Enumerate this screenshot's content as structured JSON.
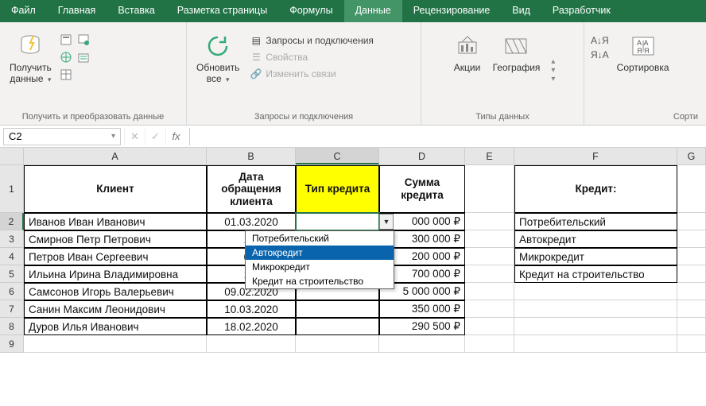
{
  "menu": [
    "Файл",
    "Главная",
    "Вставка",
    "Разметка страницы",
    "Формулы",
    "Данные",
    "Рецензирование",
    "Вид",
    "Разработчик"
  ],
  "menu_active_index": 5,
  "ribbon": {
    "groups": [
      {
        "label": "Получить и преобразовать данные",
        "get_data": "Получить\nданные"
      },
      {
        "label": "Запросы и подключения",
        "refresh": "Обновить\nвсе",
        "q_conn": "Запросы и подключения",
        "props": "Свойства",
        "edit_links": "Изменить связи"
      },
      {
        "label": "Типы данных",
        "stocks": "Акции",
        "geo": "География"
      },
      {
        "label": "Сорти",
        "sort": "Сортировка"
      }
    ]
  },
  "namebox": "C2",
  "col_letters": [
    "A",
    "B",
    "C",
    "D",
    "E",
    "F",
    "G"
  ],
  "row_heights": {
    "r1": 60,
    "rn": 22
  },
  "headers": {
    "A": "Клиент",
    "B": "Дата\nобращения\nклиента",
    "C": "Тип кредита",
    "D": "Сумма\nкредита",
    "F": "Кредит:"
  },
  "rows": [
    {
      "n": 1
    },
    {
      "n": 2,
      "A": "Иванов Иван Иванович",
      "B": "01.03.2020",
      "C": "",
      "D": "000 000 ₽",
      "F": "Потребительский"
    },
    {
      "n": 3,
      "A": "Смирнов Петр Петрович",
      "B": "15.",
      "D": "300 000 ₽",
      "F": "Автокредит"
    },
    {
      "n": 4,
      "A": "Петров Иван Сергеевич",
      "B": "03.",
      "D": "200 000 ₽",
      "F": "Микрокредит"
    },
    {
      "n": 5,
      "A": "Ильина Ирина Владимировна",
      "B": "17.",
      "D": "700 000 ₽",
      "F": "Кредит на строительство"
    },
    {
      "n": 6,
      "A": "Самсонов Игорь Валерьевич",
      "B": "09.02.2020",
      "D": "5 000 000 ₽"
    },
    {
      "n": 7,
      "A": "Санин Максим Леонидович",
      "B": "10.03.2020",
      "D": "350 000 ₽"
    },
    {
      "n": 8,
      "A": "Дуров Илья Иванович",
      "B": "18.02.2020",
      "D": "290 500 ₽"
    },
    {
      "n": 9
    }
  ],
  "dropdown": {
    "items": [
      "Потребительский",
      "Автокредит",
      "Микрокредит",
      "Кредит на строительство"
    ],
    "highlight_index": 1
  }
}
